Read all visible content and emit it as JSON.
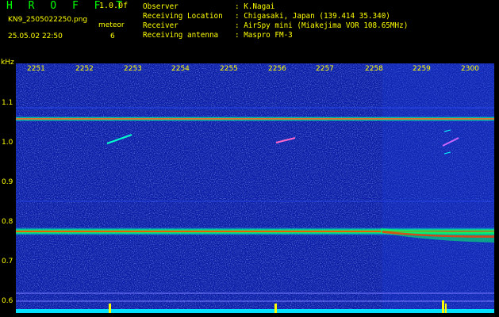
{
  "header": {
    "app_title": "H R O F F T",
    "version": "1.0.0f",
    "filename": "KN9_2505022250.png",
    "datetime": "25.05.02 22:50",
    "meteor_label": "meteor",
    "meteor_count": "6"
  },
  "info": [
    {
      "key": "Observer",
      "value": ": K.Nagai"
    },
    {
      "key": "Receiving Location",
      "value": ": Chigasaki, Japan (139.414 35.340)"
    },
    {
      "key": "Receiver",
      "value": ": AirSpy mini (Miakejima VOR 108.65MHz)"
    },
    {
      "key": "Receiving antenna",
      "value": ": Maspro FM-3"
    }
  ],
  "axis": {
    "y_unit": "kHz",
    "y_ticks": [
      "1.1",
      "1.0",
      "0.9",
      "0.8",
      "0.7",
      "0.6"
    ],
    "x_ticks": [
      "2251",
      "2252",
      "2253",
      "2254",
      "2255",
      "2256",
      "2257",
      "2258",
      "2259",
      "2300"
    ]
  },
  "colors": {
    "background": "#0a1aa0",
    "text": "#ffff00",
    "title": "#00ff00",
    "cyan": "#00ffff"
  }
}
